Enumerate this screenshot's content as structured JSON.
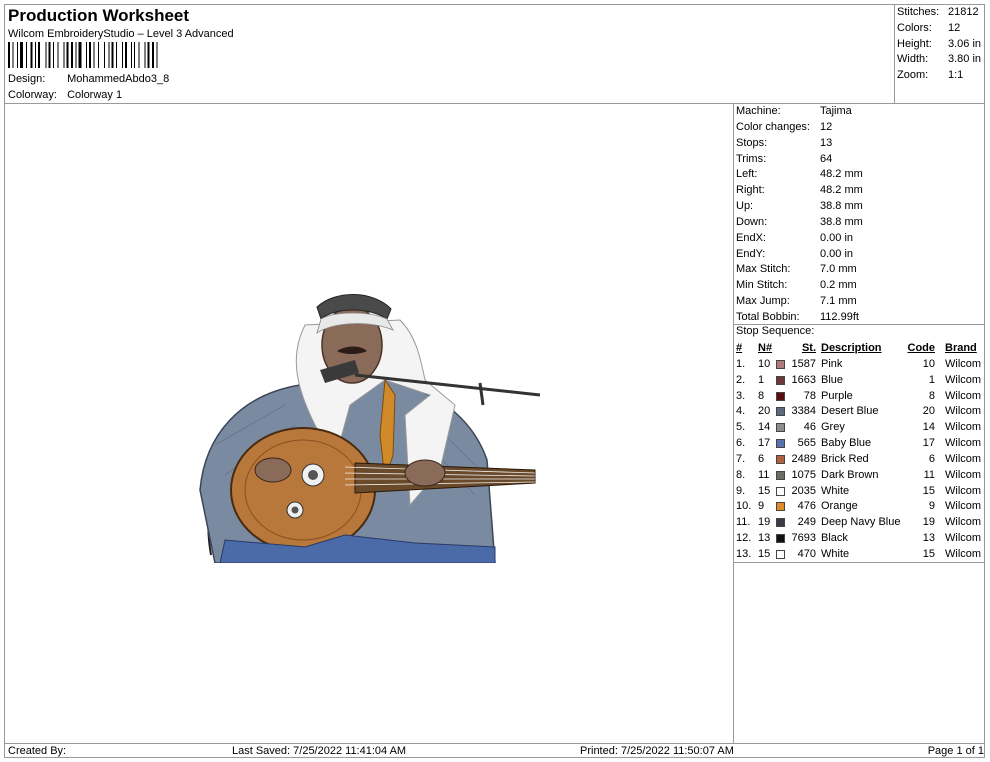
{
  "header": {
    "title": "Production Worksheet",
    "subtitle": "Wilcom EmbroideryStudio – Level 3 Advanced",
    "design_label": "Design:",
    "design_value": "MohammedAbdo3_8",
    "colorway_label": "Colorway:",
    "colorway_value": "Colorway 1"
  },
  "summary": [
    {
      "label": "Stitches:",
      "value": "21812"
    },
    {
      "label": "Colors:",
      "value": "12"
    },
    {
      "label": "Height:",
      "value": "3.06 in"
    },
    {
      "label": "Width:",
      "value": "3.80 in"
    },
    {
      "label": "Zoom:",
      "value": "1:1"
    }
  ],
  "machine_info": [
    {
      "label": "Machine:",
      "value": "Tajima"
    },
    {
      "label": "Color changes:",
      "value": "12"
    },
    {
      "label": "Stops:",
      "value": "13"
    },
    {
      "label": "Trims:",
      "value": "64"
    },
    {
      "label": "Left:",
      "value": "48.2 mm"
    },
    {
      "label": "Right:",
      "value": "48.2 mm"
    },
    {
      "label": "Up:",
      "value": "38.8 mm"
    },
    {
      "label": "Down:",
      "value": "38.8 mm"
    },
    {
      "label": "EndX:",
      "value": "0.00 in"
    },
    {
      "label": "EndY:",
      "value": "0.00 in"
    },
    {
      "label": "Max Stitch:",
      "value": "7.0 mm"
    },
    {
      "label": "Min Stitch:",
      "value": "0.2 mm"
    },
    {
      "label": "Max Jump:",
      "value": "7.1 mm"
    },
    {
      "label": "Total Bobbin:",
      "value": "112.99ft"
    }
  ],
  "stop_sequence": {
    "title": "Stop Sequence:",
    "headers": {
      "num": "#",
      "n": "N#",
      "st": "St.",
      "desc": "Description",
      "code": "Code",
      "brand": "Brand"
    },
    "rows": [
      {
        "num": "1.",
        "n": "10",
        "color": "#b07a78",
        "st": "1587",
        "desc": "Pink",
        "code": "10",
        "brand": "Wilcom"
      },
      {
        "num": "2.",
        "n": "1",
        "color": "#6a3a38",
        "st": "1663",
        "desc": "Blue",
        "code": "1",
        "brand": "Wilcom"
      },
      {
        "num": "3.",
        "n": "8",
        "color": "#5a0e0e",
        "st": "78",
        "desc": "Purple",
        "code": "8",
        "brand": "Wilcom"
      },
      {
        "num": "4.",
        "n": "20",
        "color": "#5c6a80",
        "st": "3384",
        "desc": "Desert Blue",
        "code": "20",
        "brand": "Wilcom"
      },
      {
        "num": "5.",
        "n": "14",
        "color": "#8c8c8c",
        "st": "46",
        "desc": "Grey",
        "code": "14",
        "brand": "Wilcom"
      },
      {
        "num": "6.",
        "n": "17",
        "color": "#5a72b0",
        "st": "565",
        "desc": "Baby Blue",
        "code": "17",
        "brand": "Wilcom"
      },
      {
        "num": "7.",
        "n": "6",
        "color": "#b06040",
        "st": "2489",
        "desc": "Brick Red",
        "code": "6",
        "brand": "Wilcom"
      },
      {
        "num": "8.",
        "n": "11",
        "color": "#6e6a66",
        "st": "1075",
        "desc": "Dark Brown",
        "code": "11",
        "brand": "Wilcom"
      },
      {
        "num": "9.",
        "n": "15",
        "color": "#ffffff",
        "st": "2035",
        "desc": "White",
        "code": "15",
        "brand": "Wilcom"
      },
      {
        "num": "10.",
        "n": "9",
        "color": "#e08a2a",
        "st": "476",
        "desc": "Orange",
        "code": "9",
        "brand": "Wilcom"
      },
      {
        "num": "11.",
        "n": "19",
        "color": "#3a3a48",
        "st": "249",
        "desc": "Deep Navy Blue",
        "code": "19",
        "brand": "Wilcom"
      },
      {
        "num": "12.",
        "n": "13",
        "color": "#111111",
        "st": "7693",
        "desc": "Black",
        "code": "13",
        "brand": "Wilcom"
      },
      {
        "num": "13.",
        "n": "15",
        "color": "#ffffff",
        "st": "470",
        "desc": "White",
        "code": "15",
        "brand": "Wilcom"
      }
    ]
  },
  "footer": {
    "created_by": "Created By:",
    "last_saved": "Last Saved: 7/25/2022 11:41:04 AM",
    "printed": "Printed: 7/25/2022 11:50:07 AM",
    "page": "Page 1 of 1"
  }
}
